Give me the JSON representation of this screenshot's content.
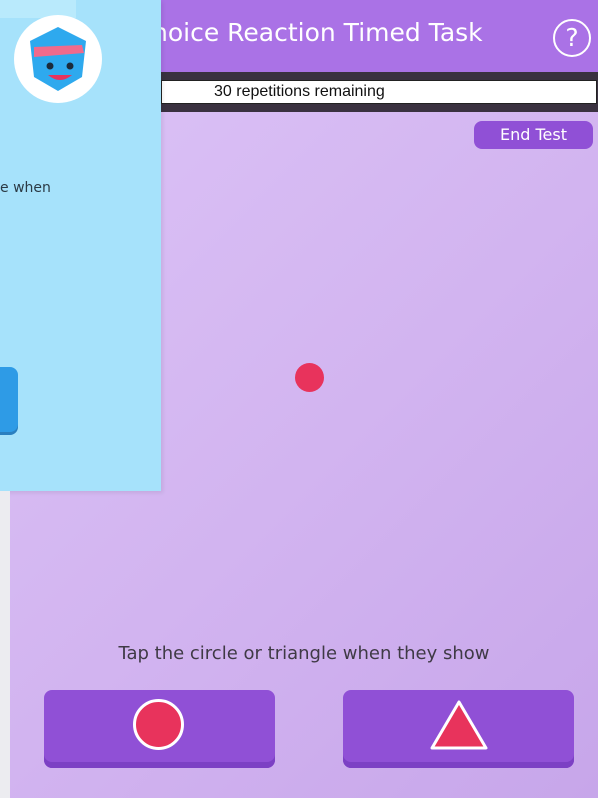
{
  "header": {
    "title": "hoice Reaction Timed Task",
    "help_label": "?"
  },
  "counter": {
    "text": "30 repetitions remaining"
  },
  "end_test_label": "End Test",
  "instruction": "Tap the circle or triangle when they show",
  "overlay": {
    "text_fragment": "e when"
  },
  "colors": {
    "header": "#aa72e6",
    "button": "#9050d6",
    "stimulus": "#e8335c",
    "overlay": "#a6e2fb"
  },
  "icons": {
    "help": "question-circle-icon",
    "circle_response": "circle-icon",
    "triangle_response": "triangle-icon",
    "avatar": "robot-mascot-icon"
  }
}
